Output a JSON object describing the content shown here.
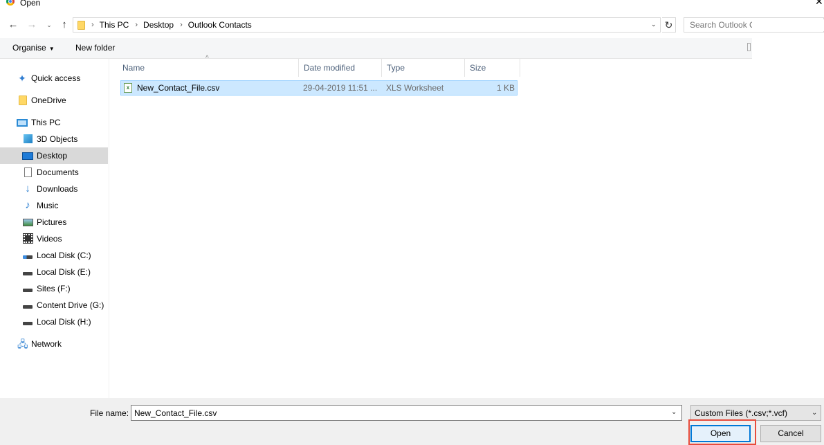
{
  "window": {
    "title": "Open"
  },
  "nav_buttons": {
    "back": "←",
    "forward": "→",
    "recent": "⌄",
    "up": "↑"
  },
  "address": {
    "crumbs": [
      "This PC",
      "Desktop",
      "Outlook Contacts"
    ],
    "separator": "›",
    "dropdown": "⌄",
    "refresh": "↻"
  },
  "search": {
    "placeholder": "Search Outlook C..."
  },
  "toolbar": {
    "organise": "Organise",
    "organise_arrow": "▼",
    "new_folder": "New folder"
  },
  "nav_pane": {
    "items": [
      {
        "label": "Quick access",
        "icon": "star-icon"
      },
      {
        "label": "OneDrive",
        "icon": "folder-icon"
      },
      {
        "label": "This PC",
        "icon": "computer-icon"
      },
      {
        "label": "3D Objects",
        "icon": "cube-icon"
      },
      {
        "label": "Desktop",
        "icon": "desktop-icon",
        "selected": true
      },
      {
        "label": "Documents",
        "icon": "document-icon"
      },
      {
        "label": "Downloads",
        "icon": "download-icon"
      },
      {
        "label": "Music",
        "icon": "music-icon"
      },
      {
        "label": "Pictures",
        "icon": "picture-icon"
      },
      {
        "label": "Videos",
        "icon": "video-icon"
      },
      {
        "label": "Local Disk (C:)",
        "icon": "system-disk-icon"
      },
      {
        "label": "Local Disk (E:)",
        "icon": "disk-icon"
      },
      {
        "label": "Sites (F:)",
        "icon": "disk-icon"
      },
      {
        "label": "Content Drive (G:)",
        "icon": "disk-icon"
      },
      {
        "label": "Local Disk (H:)",
        "icon": "disk-icon"
      },
      {
        "label": "Network",
        "icon": "network-icon"
      }
    ]
  },
  "file_list": {
    "columns": [
      "Name",
      "Date modified",
      "Type",
      "Size"
    ],
    "sort_indicator": "^",
    "rows": [
      {
        "name": "New_Contact_File.csv",
        "date": "29-04-2019 11:51 ...",
        "type": "XLS Worksheet",
        "size": "1 KB",
        "selected": true
      }
    ]
  },
  "footer": {
    "file_name_label": "File name:",
    "file_name_value": "New_Contact_File.csv",
    "file_name_arrow": "⌄",
    "file_type": "Custom Files (*.csv;*.vcf)",
    "file_type_arrow": "⌄",
    "open": "Open",
    "cancel": "Cancel"
  },
  "colors": {
    "selection": "#cce8ff",
    "selection_border": "#99d1ff",
    "nav_selected": "#d9d9d9",
    "open_border": "#0078d7",
    "highlight": "#e74c3c"
  }
}
